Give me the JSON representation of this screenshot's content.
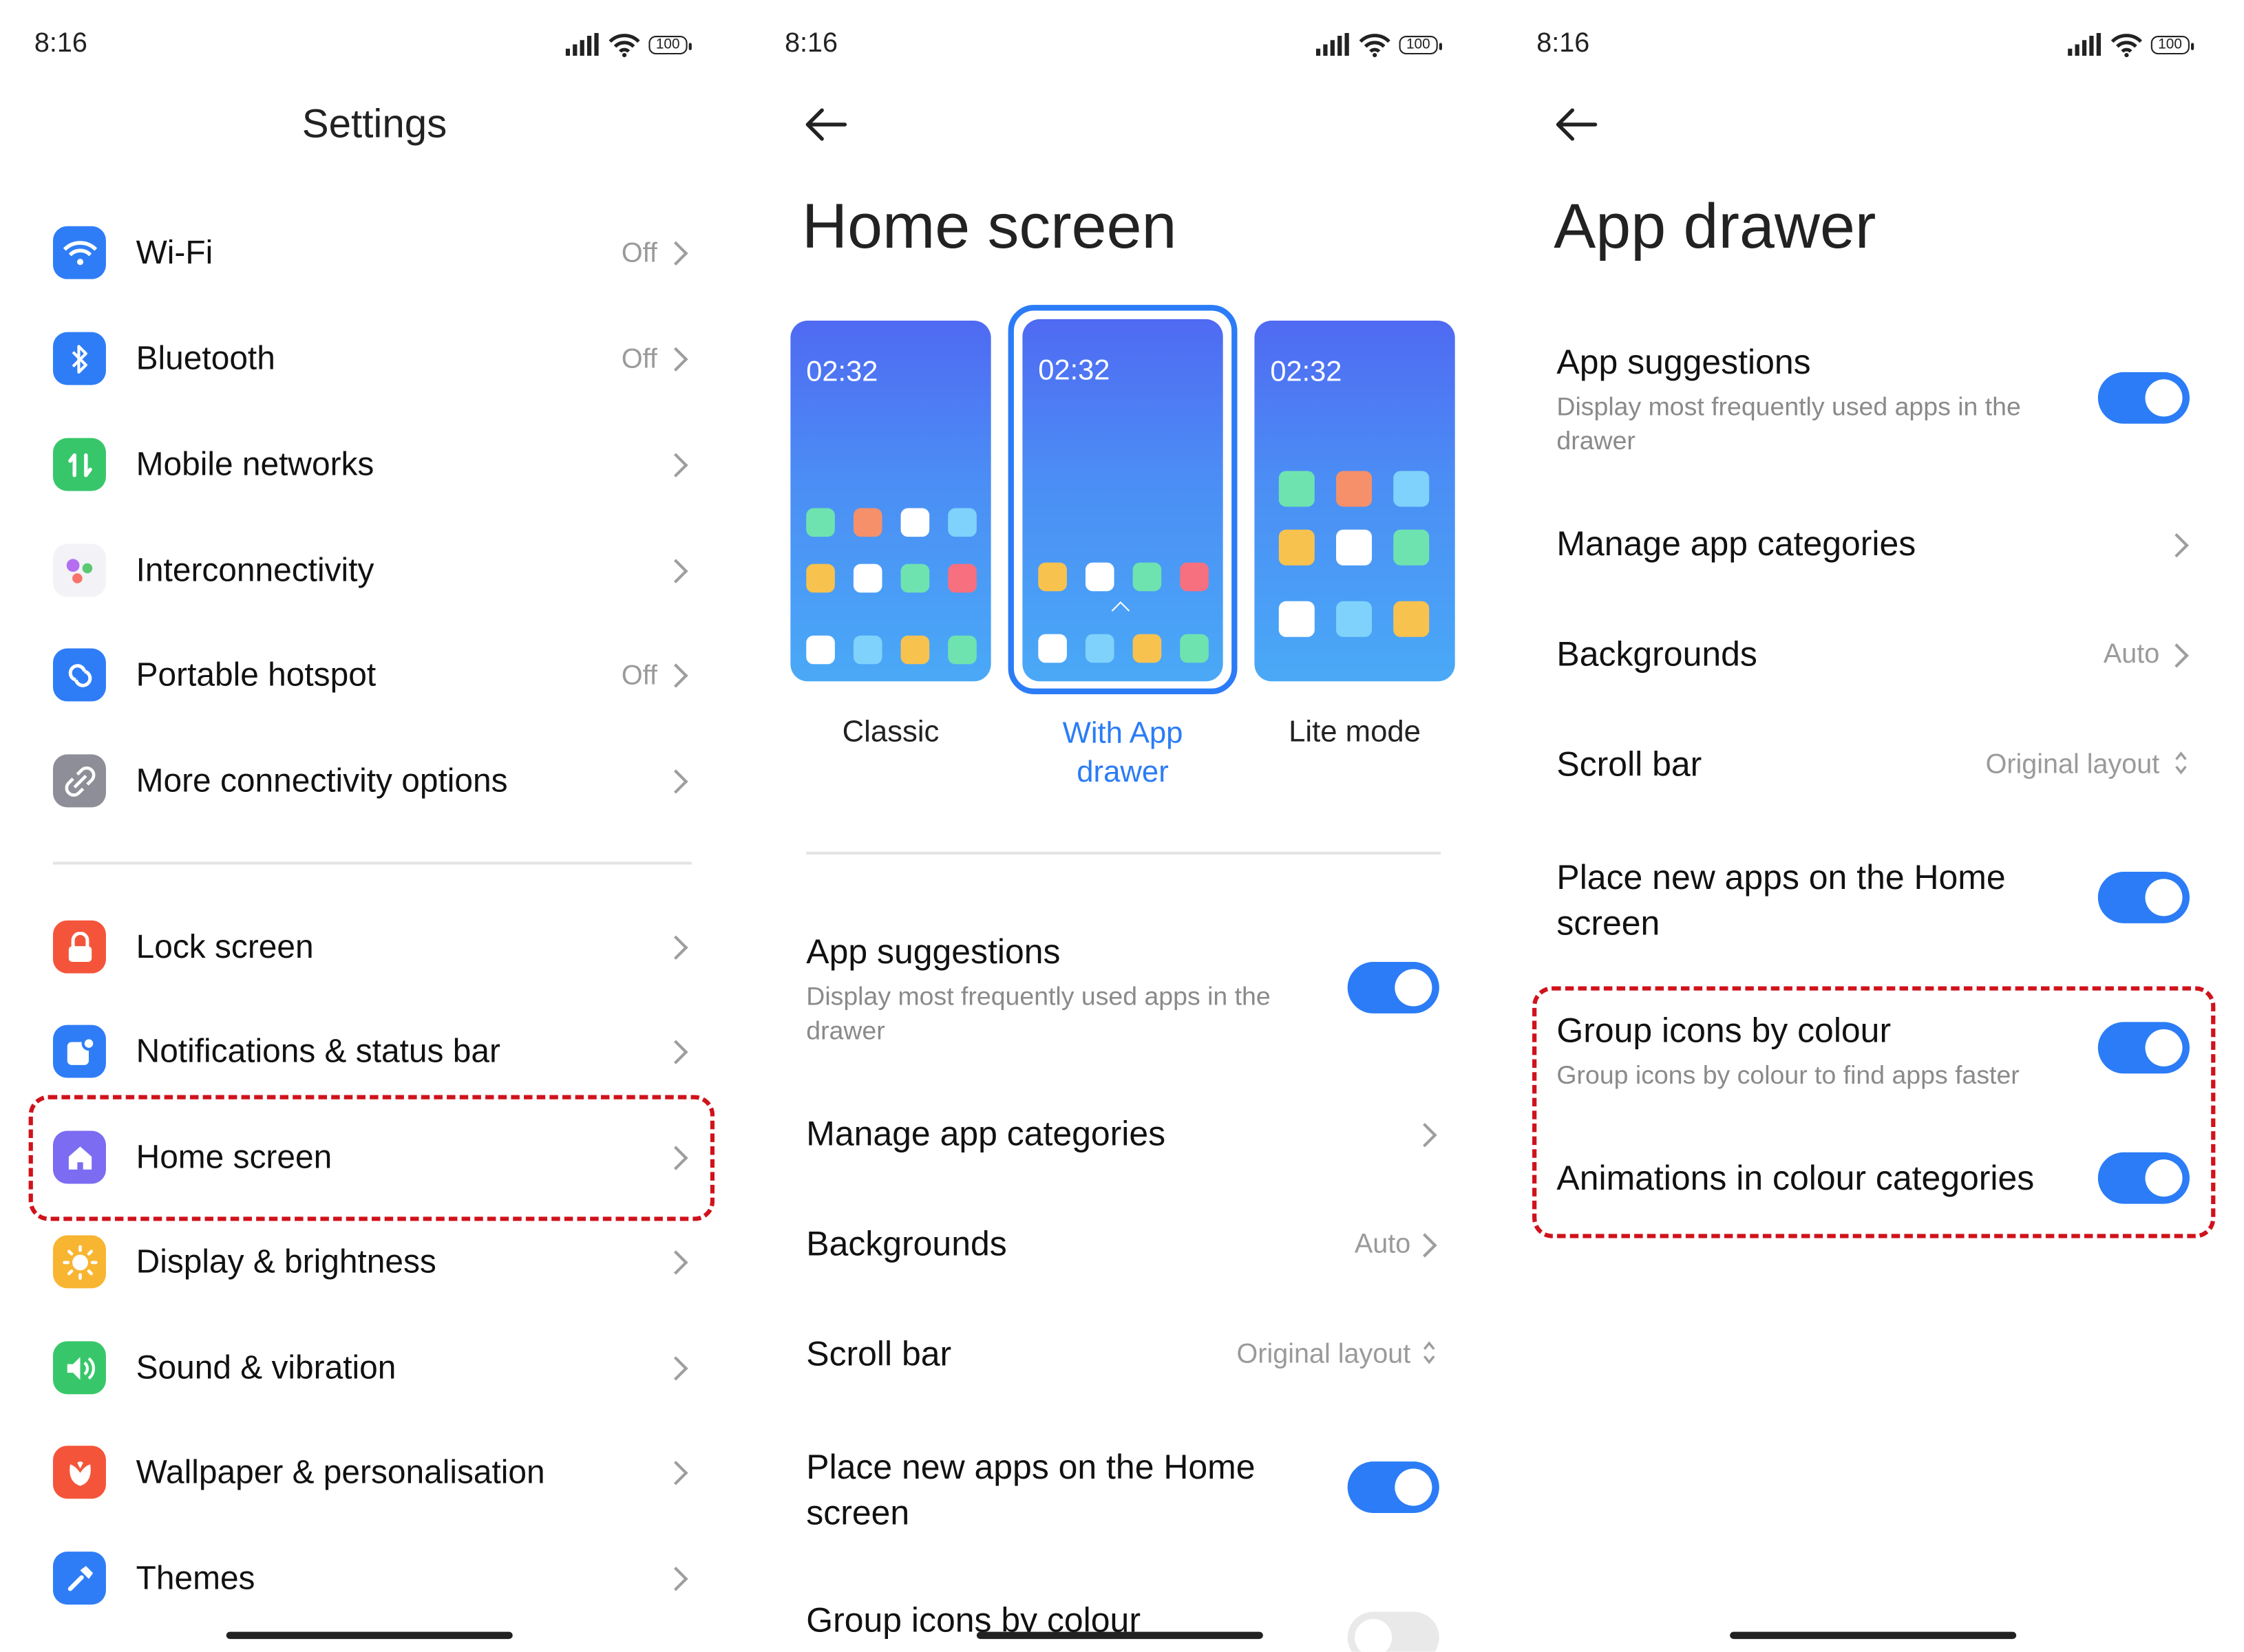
{
  "status": {
    "time": "8:16",
    "battery": "100"
  },
  "panel1": {
    "title": "Settings",
    "group1": [
      {
        "label": "Wi-Fi",
        "value": "Off",
        "icon": "wifi-icon",
        "color": "#2f7df6"
      },
      {
        "label": "Bluetooth",
        "value": "Off",
        "icon": "bluetooth-icon",
        "color": "#2f7df6"
      },
      {
        "label": "Mobile networks",
        "value": "",
        "icon": "mobile-networks-icon",
        "color": "#37c76a"
      },
      {
        "label": "Interconnectivity",
        "value": "",
        "icon": "interconnectivity-icon",
        "color": "#f2f2f7"
      },
      {
        "label": "Portable hotspot",
        "value": "Off",
        "icon": "hotspot-icon",
        "color": "#2f7df6"
      },
      {
        "label": "More connectivity options",
        "value": "",
        "icon": "more-connectivity-icon",
        "color": "#8e8e98"
      }
    ],
    "group2": [
      {
        "label": "Lock screen",
        "icon": "lock-icon",
        "color": "#f4553a"
      },
      {
        "label": "Notifications & status bar",
        "icon": "notifications-icon",
        "color": "#2f7df6"
      },
      {
        "label": "Home screen",
        "icon": "home-icon",
        "color": "#7b6cf2"
      },
      {
        "label": "Display & brightness",
        "icon": "brightness-icon",
        "color": "#f8b531"
      },
      {
        "label": "Sound & vibration",
        "icon": "sound-icon",
        "color": "#37c76a"
      },
      {
        "label": "Wallpaper & personalisation",
        "icon": "wallpaper-icon",
        "color": "#f4553a"
      },
      {
        "label": "Themes",
        "icon": "themes-icon",
        "color": "#2f7df6"
      }
    ]
  },
  "panel2": {
    "title": "Home screen",
    "modes": [
      {
        "time": "02:32",
        "label": "Classic",
        "selected": false
      },
      {
        "time": "02:32",
        "label_line1": "With App",
        "label_line2": "drawer",
        "selected": true
      },
      {
        "time": "02:32",
        "label": "Lite mode",
        "selected": false
      }
    ],
    "app_suggestions": {
      "title": "App suggestions",
      "subtitle_line1": "Display most frequently used apps in the",
      "subtitle_line2": "drawer",
      "on": true
    },
    "manage_categories": "Manage app categories",
    "backgrounds": {
      "label": "Backgrounds",
      "value": "Auto"
    },
    "scroll_bar": {
      "label": "Scroll bar",
      "value": "Original layout"
    },
    "place_new": {
      "line1": "Place new apps on the Home",
      "line2": "screen",
      "on": true
    },
    "group_icons": {
      "title": "Group icons by colour",
      "on": false
    }
  },
  "panel3": {
    "title": "App drawer",
    "app_suggestions": {
      "title": "App suggestions",
      "subtitle_line1": "Display most frequently used apps in the",
      "subtitle_line2": "drawer",
      "on": true
    },
    "manage_categories": "Manage app categories",
    "backgrounds": {
      "label": "Backgrounds",
      "value": "Auto"
    },
    "scroll_bar": {
      "label": "Scroll bar",
      "value": "Original layout"
    },
    "place_new": {
      "line1": "Place new apps on the Home",
      "line2": "screen",
      "on": true
    },
    "group_icons": {
      "title": "Group icons by colour",
      "subtitle": "Group icons by colour to find apps faster",
      "on": true
    },
    "animations": {
      "title": "Animations in colour categories",
      "on": true
    }
  },
  "colors": {
    "accent": "#2b7cf6",
    "highlight": "#d0121b",
    "toggle_off": "#e9e9e9"
  }
}
